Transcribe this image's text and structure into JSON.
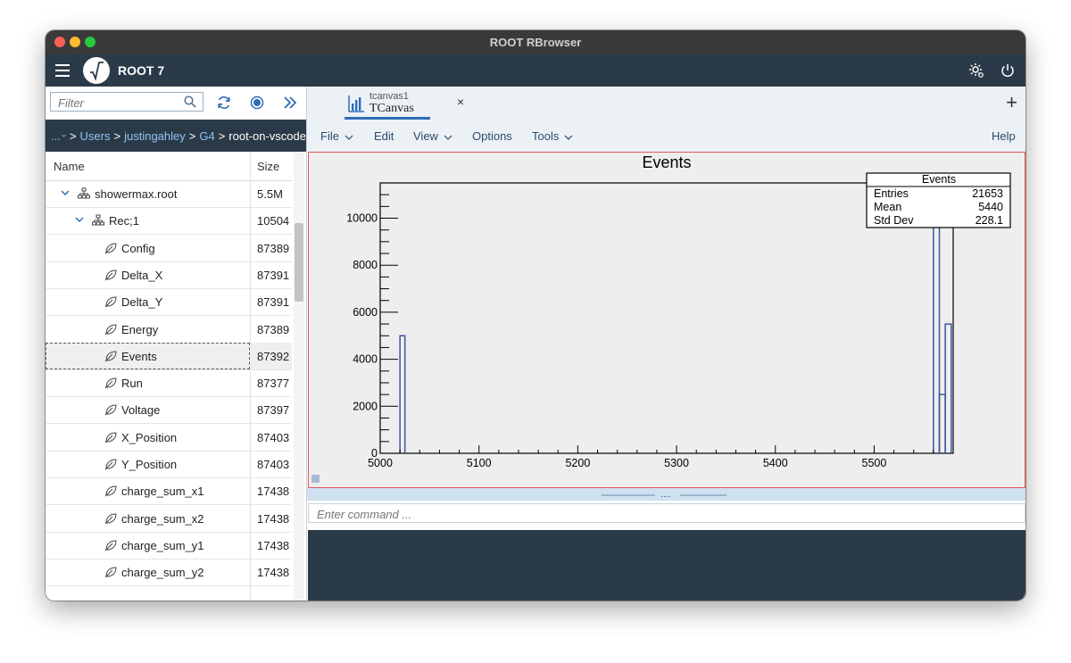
{
  "window": {
    "title": "ROOT RBrowser"
  },
  "app": {
    "title": "ROOT 7"
  },
  "filter": {
    "placeholder": "Filter"
  },
  "breadcrumb": {
    "ellipsis": "...",
    "items": [
      "Users",
      "justingahley",
      "G4"
    ],
    "current": "root-on-vscode",
    "separator": ">"
  },
  "table": {
    "headers": {
      "name": "Name",
      "size": "Size"
    },
    "rows": [
      {
        "name": "showermax.root",
        "size": "5.5M",
        "type": "file",
        "expanded": true
      },
      {
        "name": "Rec;1",
        "size": "10504",
        "type": "tree",
        "expanded": true
      },
      {
        "name": "Config",
        "size": "87389",
        "type": "leaf"
      },
      {
        "name": "Delta_X",
        "size": "87391",
        "type": "leaf"
      },
      {
        "name": "Delta_Y",
        "size": "87391",
        "type": "leaf"
      },
      {
        "name": "Energy",
        "size": "87389",
        "type": "leaf"
      },
      {
        "name": "Events",
        "size": "87392",
        "type": "leaf",
        "selected": true
      },
      {
        "name": "Run",
        "size": "87377",
        "type": "leaf"
      },
      {
        "name": "Voltage",
        "size": "87397",
        "type": "leaf"
      },
      {
        "name": "X_Position",
        "size": "87403",
        "type": "leaf"
      },
      {
        "name": "Y_Position",
        "size": "87403",
        "type": "leaf"
      },
      {
        "name": "charge_sum_x1",
        "size": "17438",
        "type": "leaf"
      },
      {
        "name": "charge_sum_x2",
        "size": "17438",
        "type": "leaf"
      },
      {
        "name": "charge_sum_y1",
        "size": "17438",
        "type": "leaf"
      },
      {
        "name": "charge_sum_y2",
        "size": "17438",
        "type": "leaf"
      }
    ]
  },
  "tab": {
    "subtitle": "tcanvas1",
    "title": "TCanvas",
    "close": "×"
  },
  "tabstrip": {
    "add": "+"
  },
  "menubar": {
    "file": "File",
    "edit": "Edit",
    "view": "View",
    "options": "Options",
    "tools": "Tools",
    "help": "Help"
  },
  "command": {
    "placeholder": "Enter command ..."
  },
  "splitter": {
    "handle": "...."
  },
  "chart_data": {
    "type": "bar",
    "title": "Events",
    "xlim": [
      5000,
      5580
    ],
    "ylim": [
      0,
      11500
    ],
    "xticks": [
      5000,
      5100,
      5200,
      5300,
      5400,
      5500
    ],
    "yticks": [
      0,
      2000,
      4000,
      6000,
      8000,
      10000
    ],
    "bins": [
      {
        "x0": 5020,
        "x1": 5025,
        "y": 5000
      },
      {
        "x0": 5560,
        "x1": 5566,
        "y": 11500
      },
      {
        "x0": 5566,
        "x1": 5572,
        "y": 2500
      },
      {
        "x0": 5572,
        "x1": 5578,
        "y": 5500
      }
    ],
    "stats": {
      "title": "Events",
      "rows": [
        {
          "label": "Entries",
          "value": "21653"
        },
        {
          "label": "Mean",
          "value": "5440"
        },
        {
          "label": "Std Dev",
          "value": "228.1"
        }
      ]
    },
    "line_color": "#3a55a0"
  }
}
